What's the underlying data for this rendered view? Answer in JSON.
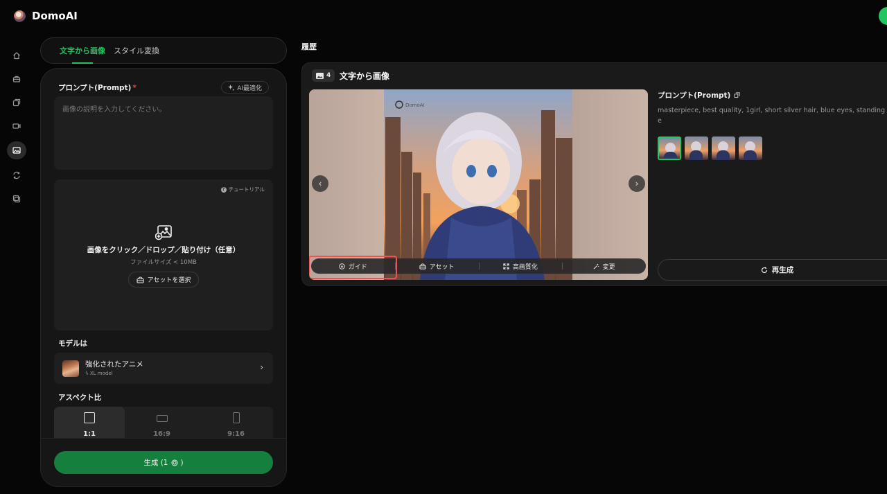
{
  "app": {
    "name": "DomoAI"
  },
  "rail": {
    "items": [
      "home-icon",
      "toolbox-icon",
      "layers-icon",
      "video-icon",
      "image-icon",
      "refresh-icon",
      "copy-icon"
    ],
    "active_index": 4
  },
  "tabs": [
    {
      "label": "文字から画像",
      "active": true
    },
    {
      "label": "スタイル変換",
      "active": false
    }
  ],
  "prompt": {
    "label": "プロンプト(Prompt)",
    "required_mark": "*",
    "ai_button": "AI最適化",
    "placeholder": "画像の説明を入力してください。",
    "value": ""
  },
  "upload": {
    "tutorial": "チュートリアル",
    "main": "画像をクリック／ドロップ／貼り付け（任意）",
    "sub": "ファイルサイズ < 10MB",
    "asset_button": "アセットを選択"
  },
  "model": {
    "label": "モデルは",
    "name": "強化されたアニメ",
    "sub": "XL model"
  },
  "aspect": {
    "label": "アスペクト比",
    "options": [
      {
        "label": "1:1",
        "active": true
      },
      {
        "label": "16:9",
        "active": false
      },
      {
        "label": "9:16",
        "active": false
      }
    ]
  },
  "generate": {
    "label": "生成 (1",
    "suffix": ")"
  },
  "history": {
    "title": "履歴",
    "card": {
      "count": "4",
      "title": "文字から画像",
      "watermark": "DomoAI",
      "actions": [
        "ガイド",
        "アセット",
        "高画質化",
        "変更"
      ],
      "side_prompt_label": "プロンプト(Prompt)",
      "side_prompt_text": "masterpiece, best quality, 1girl, short silver hair, blue eyes, standing e",
      "thumb_count": 4,
      "selected_thumb": 0,
      "regen": "再生成"
    }
  },
  "colors": {
    "accent": "#22c55e",
    "highlight": "#f05252",
    "generate_bg": "#15803d"
  }
}
